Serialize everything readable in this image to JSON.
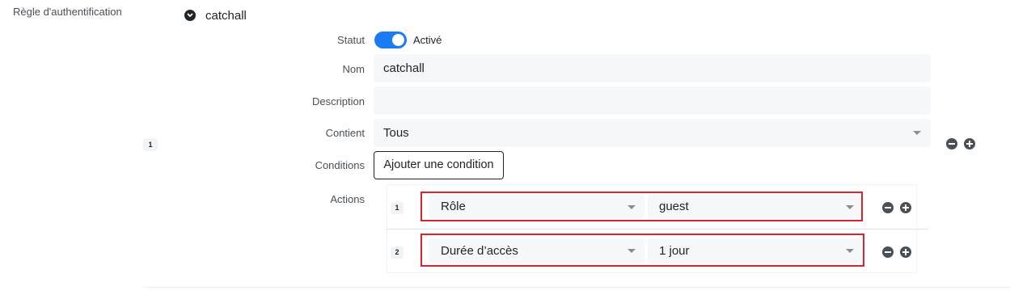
{
  "section": {
    "label": "Règle d'authentification"
  },
  "rule": {
    "name": "catchall",
    "index": "1",
    "status": {
      "label": "Statut",
      "state_text": "Activé",
      "enabled": true
    },
    "name_field": {
      "label": "Nom",
      "value": "catchall"
    },
    "description_field": {
      "label": "Description",
      "value": ""
    },
    "contains_field": {
      "label": "Contient",
      "value": "Tous"
    },
    "conditions": {
      "label": "Conditions",
      "button": "Ajouter une condition"
    },
    "actions": {
      "label": "Actions",
      "items": [
        {
          "index": "1",
          "type": "Rôle",
          "value": "guest"
        },
        {
          "index": "2",
          "type": "Durée d’accès",
          "value": "1 jour"
        }
      ]
    }
  },
  "colors": {
    "accent": "#1a7bf5",
    "highlight": "#d9232e"
  },
  "icons": {
    "expand": "chevron-down-icon",
    "remove": "minus-circle-icon",
    "add": "plus-circle-icon"
  }
}
